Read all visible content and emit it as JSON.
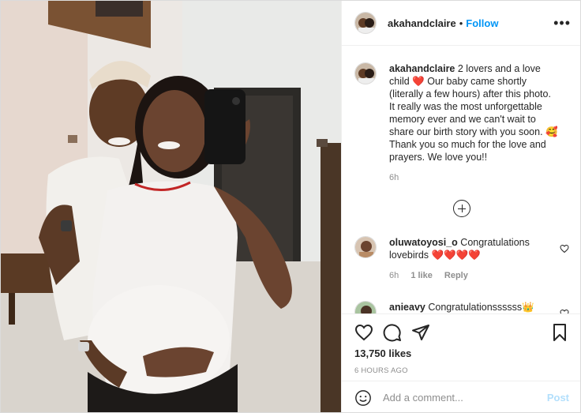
{
  "post": {
    "author": "akahandclaire",
    "follow_label": "Follow",
    "separator": "•",
    "more_icon": "more-horizontal-icon"
  },
  "caption": {
    "author": "akahandclaire",
    "text_1": " 2 lovers and a love child ",
    "emoji_1": "❤️",
    "text_2": " Our baby came shortly (literally a few hours) after this photo. It really was the most unforgettable memory ever and we can't wait to share our birth story with you soon. ",
    "emoji_2": "🥰",
    "text_3": " Thank you so much for the love and prayers. We love you!!",
    "time": "6h"
  },
  "load_more_icon": "plus-circle-icon",
  "comments": [
    {
      "user": "oluwatoyosi_o",
      "text": " Congratulations lovebirds ",
      "hearts": "❤️❤️❤️❤️",
      "time": "6h",
      "likes": "1 like",
      "reply": "Reply"
    },
    {
      "user": "anieavy",
      "text": " Congratulationssssss",
      "hearts": "👑"
    }
  ],
  "actions": {
    "likes": "13,750 likes",
    "time_ago": "6 HOURS AGO"
  },
  "add_comment": {
    "placeholder": "Add a comment...",
    "post_label": "Post"
  },
  "colors": {
    "accent": "#0095f6",
    "post_disabled": "#b2dffc",
    "muted": "#8e8e8e",
    "heart": "#ed1c24"
  }
}
